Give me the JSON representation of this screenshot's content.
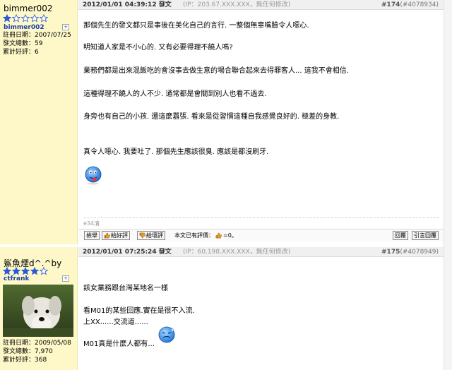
{
  "posts": [
    {
      "user": {
        "display_name": "bimmer002",
        "stars_filled": 1,
        "stars_total": 5,
        "user_id": "bimmer002",
        "reg_date": "註冊日期：2007/07/25",
        "post_count": "發文總數：59",
        "score": "累計好評：6"
      },
      "header": {
        "date": "2012/01/01 04:39:12 發文",
        "ip": "(IP：203.67.XXX.XXX，無任何修改)",
        "num": "#174",
        "id": "(#4078934)"
      },
      "lines": [
        "那個先生的發文都只是事後在美化自己的言行. 一整個無辜嘴臉令人噁心.",
        "明知道人家是不小心的. 又有必要得理不饒人嗎?",
        "業務們都是出來混飯吃的會沒事去做生意的場合聯合起來去得罪客人... 這我不會相信.",
        "這種得理不饒人的人不少. 通常都是會關到別人也看不過去.",
        "身旁也有自己的小孩. 還這麼囂張. 看來是從習慣這種自我感覺良好的. 極差的身教.",
        "真令人噁心. 我要吐了. 那個先生應該很臭. 應該是都沒刷牙."
      ],
      "signature": "e34清",
      "toolbar": {
        "report": "檢舉",
        "like": "給好評",
        "dislike": "給壞評",
        "rated_label": "本文已有評價：",
        "rated_value": "=0。",
        "reply": "回覆",
        "quote_reply": "引言回覆"
      }
    },
    {
      "user": {
        "display_name": "鯊魚煙d^.^by",
        "stars_filled": 4,
        "stars_total": 5,
        "user_id": "ctfrank",
        "reg_date": "註冊日期：2009/05/08",
        "post_count": "發文總數：7,970",
        "score": "累計好評：368"
      },
      "header": {
        "date": "2012/01/01 07:25:24 發文",
        "ip": "(IP：60.198.XXX.XXX，無任何修改)",
        "num": "#175",
        "id": "(#4078949)"
      },
      "lines": [
        "該女業務跟台灣某地名一樣",
        "看M01的某些回應.實在是很不入流.",
        "上XX......交流道......",
        "M01真是什麼人都有..."
      ]
    }
  ]
}
